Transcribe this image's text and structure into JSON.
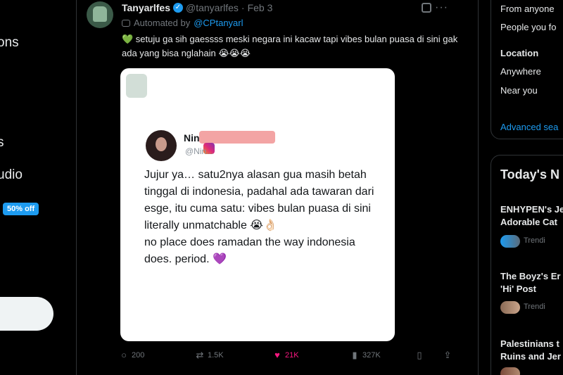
{
  "nav": {
    "item_1": "ons",
    "item_2": "s",
    "item_3": "udio",
    "promo": "50% off"
  },
  "tweet": {
    "display_name": "Tanyarlfes",
    "handle": "@tanyarlfes",
    "separator": "·",
    "date": "Feb 3",
    "more": "···",
    "automated_prefix": "Automated by",
    "automated_handle": "@CPtanyarl",
    "text": "💚 setuju ga sih gaessss meski negara ini kacaw tapi vibes bulan puasa di sini gak ada yang bisa nglahain 😭😭😭",
    "card": {
      "name": "Nin",
      "handle": "@Nin...",
      "text": "Jujur ya… satu2nya alasan gua masih betah tinggal di indonesia, padahal ada tawaran dari esge, itu cuma satu: vibes bulan puasa di sini literally unmatchable 😭👌🏻\nno place does ramadan the way indonesia does. period. 💜"
    },
    "stats": {
      "replies": "200",
      "reposts": "1.5K",
      "likes": "21K",
      "views": "327K"
    },
    "icons": {
      "reply": "reply-icon",
      "repost": "repost-icon",
      "like": "heart-icon",
      "views": "views-icon",
      "bookmark": "bookmark-icon",
      "share": "share-icon"
    }
  },
  "search_filters": {
    "people_option_1": "From anyone",
    "people_option_2": "People you fo",
    "location_label": "Location",
    "location_option_1": "Anywhere",
    "location_option_2": "Near you",
    "advanced": "Advanced sea"
  },
  "news": {
    "title": "Today's N",
    "items": [
      {
        "line1": "ENHYPEN's Je",
        "line2": "Adorable Cat",
        "meta": "Trendi"
      },
      {
        "line1": "The Boyz's Er",
        "line2": "'Hi' Post",
        "meta": "Trendi"
      },
      {
        "line1": "Palestinians t",
        "line2": "Ruins and Jer"
      }
    ]
  },
  "colors": {
    "accent": "#1d9bf0",
    "like": "#f91880",
    "border": "#2f3336",
    "muted": "#71767b"
  }
}
